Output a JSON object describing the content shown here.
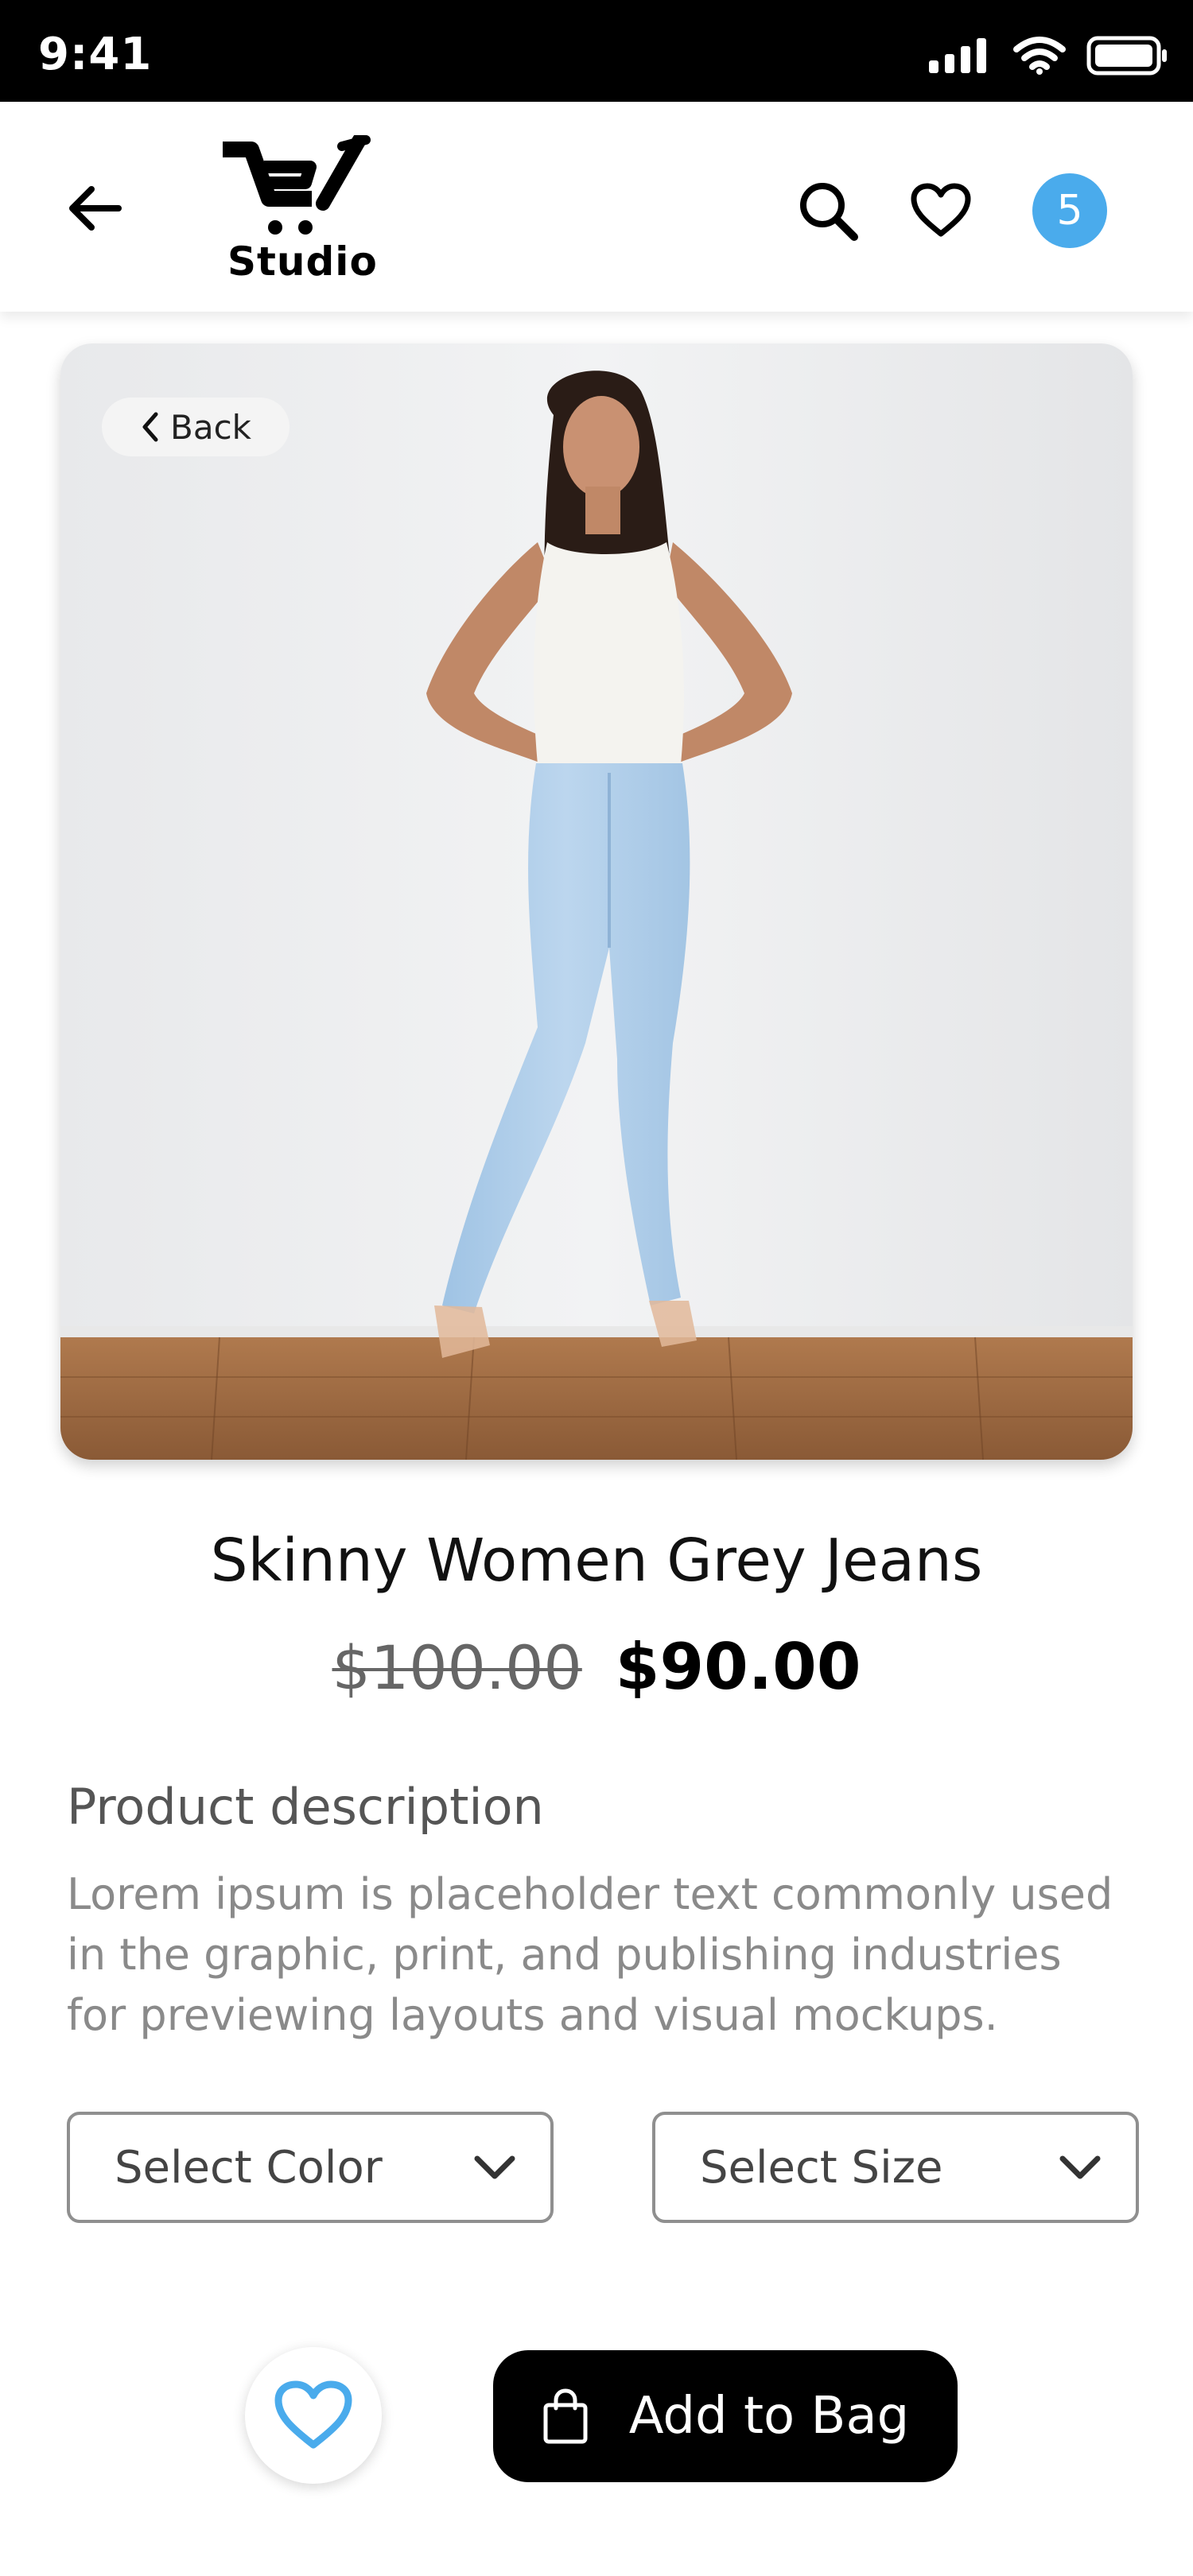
{
  "status_bar": {
    "time": "9:41"
  },
  "header": {
    "logo_text": "Studio",
    "cart_count": "5"
  },
  "image": {
    "back_label": "Back"
  },
  "product": {
    "title": "Skinny Women Grey Jeans",
    "price_original": "$100.00",
    "price_sale": "$90.00"
  },
  "description": {
    "heading": "Product description",
    "text": "Lorem ipsum is placeholder text commonly used in the graphic, print, and publishing industries for previewing layouts and visual mockups."
  },
  "selectors": {
    "color_label": "Select Color",
    "size_label": "Select Size"
  },
  "actions": {
    "add_to_bag_label": "Add to Bag"
  },
  "colors": {
    "accent": "#4aabec",
    "button": "#000000",
    "muted_text": "#8a8a8a"
  }
}
